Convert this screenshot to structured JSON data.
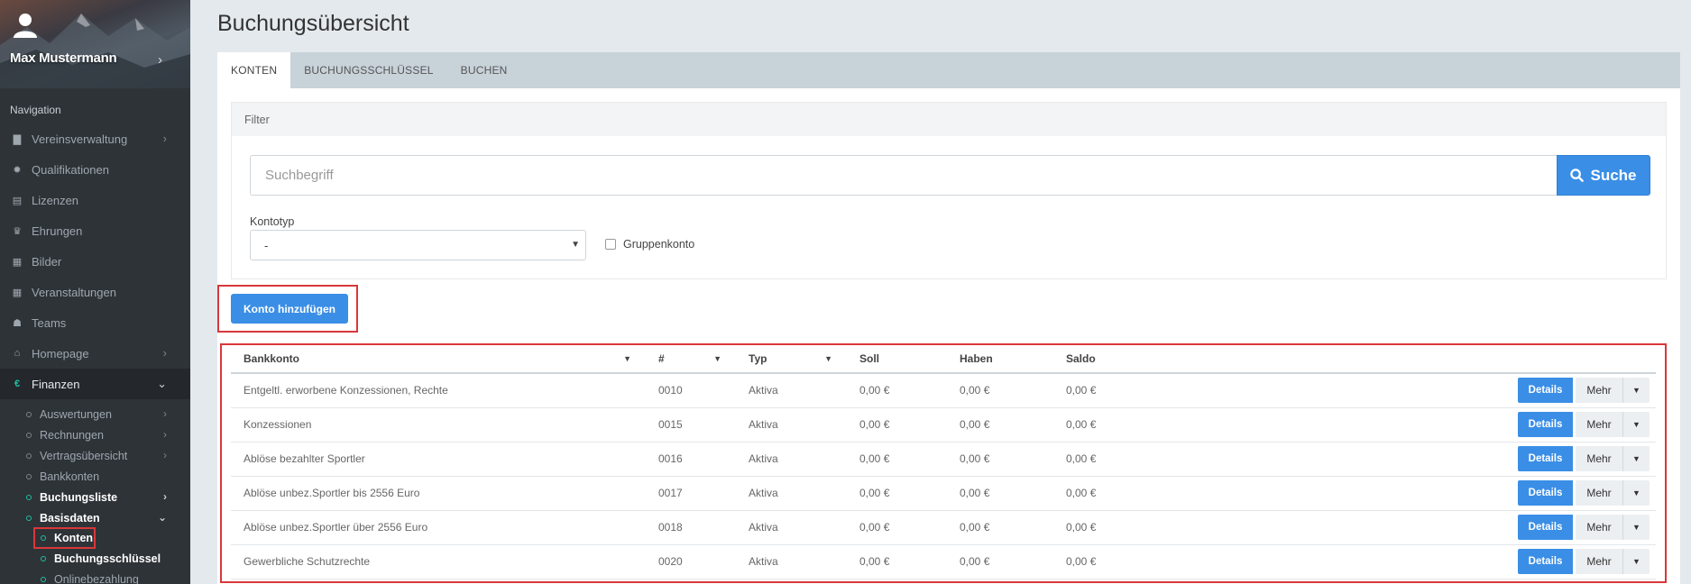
{
  "user": {
    "name": "Max Mustermann"
  },
  "sidebar": {
    "nav_title": "Navigation",
    "items": [
      {
        "label": "Vereinsverwaltung",
        "icon": "book-icon",
        "glyph": "▇",
        "has_arrow": true
      },
      {
        "label": "Qualifikationen",
        "icon": "certificate-icon",
        "glyph": "✹",
        "has_arrow": false
      },
      {
        "label": "Lizenzen",
        "icon": "id-card-icon",
        "glyph": "▤",
        "has_arrow": false
      },
      {
        "label": "Ehrungen",
        "icon": "trophy-icon",
        "glyph": "♛",
        "has_arrow": false
      },
      {
        "label": "Bilder",
        "icon": "file-icon",
        "glyph": "▦",
        "has_arrow": false
      },
      {
        "label": "Veranstaltungen",
        "icon": "calendar-icon",
        "glyph": "▦",
        "has_arrow": false
      },
      {
        "label": "Teams",
        "icon": "users-icon",
        "glyph": "☗",
        "has_arrow": false
      },
      {
        "label": "Homepage",
        "icon": "home-icon",
        "glyph": "⌂",
        "has_arrow": true
      },
      {
        "label": "Finanzen",
        "icon": "euro-icon",
        "glyph": "€",
        "has_arrow": true,
        "active": true
      }
    ],
    "finanzen_sub": [
      {
        "label": "Auswertungen",
        "has_arrow": true
      },
      {
        "label": "Rechnungen",
        "has_arrow": true
      },
      {
        "label": "Vertragsübersicht",
        "has_arrow": true
      },
      {
        "label": "Bankkonten",
        "has_arrow": false
      },
      {
        "label": "Buchungsliste",
        "has_arrow": true,
        "bold": true
      },
      {
        "label": "Basisdaten",
        "has_arrow": true,
        "bold": true,
        "open": true
      }
    ],
    "basisdaten_sub": [
      {
        "label": "Konten",
        "bold": true,
        "highlight": true
      },
      {
        "label": "Buchungsschlüssel",
        "bold": true
      },
      {
        "label": "Onlinebezahlung",
        "bold": false
      }
    ]
  },
  "page": {
    "title": "Buchungsübersicht"
  },
  "tabs": [
    {
      "label": "KONTEN",
      "active": true
    },
    {
      "label": "BUCHUNGSSCHLÜSSEL",
      "active": false
    },
    {
      "label": "BUCHEN",
      "active": false
    }
  ],
  "filter": {
    "title": "Filter",
    "search_placeholder": "Suchbegriff",
    "search_button": "Suche",
    "kontotyp_label": "Kontotyp",
    "kontotyp_value": "-",
    "gruppenkonto_label": "Gruppenkonto",
    "gruppenkonto_checked": false
  },
  "add_button": "Konto hinzufügen",
  "table": {
    "columns": [
      "Bankkonto",
      "#",
      "Typ",
      "Soll",
      "Haben",
      "Saldo"
    ],
    "rows": [
      {
        "bankkonto": "Entgeltl. erworbene Konzessionen, Rechte",
        "nr": "0010",
        "typ": "Aktiva",
        "soll": "0,00 €",
        "haben": "0,00 €",
        "saldo": "0,00 €"
      },
      {
        "bankkonto": "Konzessionen",
        "nr": "0015",
        "typ": "Aktiva",
        "soll": "0,00 €",
        "haben": "0,00 €",
        "saldo": "0,00 €"
      },
      {
        "bankkonto": "Ablöse bezahlter Sportler",
        "nr": "0016",
        "typ": "Aktiva",
        "soll": "0,00 €",
        "haben": "0,00 €",
        "saldo": "0,00 €"
      },
      {
        "bankkonto": "Ablöse unbez.Sportler bis 2556 Euro",
        "nr": "0017",
        "typ": "Aktiva",
        "soll": "0,00 €",
        "haben": "0,00 €",
        "saldo": "0,00 €"
      },
      {
        "bankkonto": "Ablöse unbez.Sportler über 2556 Euro",
        "nr": "0018",
        "typ": "Aktiva",
        "soll": "0,00 €",
        "haben": "0,00 €",
        "saldo": "0,00 €"
      },
      {
        "bankkonto": "Gewerbliche Schutzrechte",
        "nr": "0020",
        "typ": "Aktiva",
        "soll": "0,00 €",
        "haben": "0,00 €",
        "saldo": "0,00 €"
      }
    ],
    "details_label": "Details",
    "mehr_label": "Mehr"
  },
  "colors": {
    "accent": "#3a8ee6",
    "sidebar_bg": "#2e3338",
    "highlight": "#d9383a",
    "active_icon": "#1fbfa0"
  }
}
